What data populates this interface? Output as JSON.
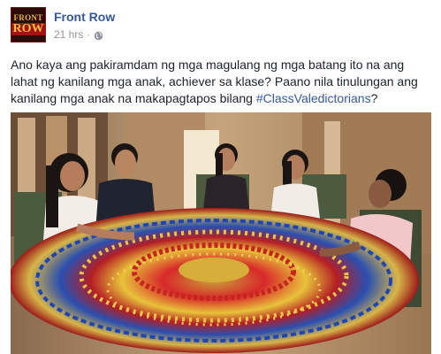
{
  "post": {
    "page_name": "Front Row",
    "timestamp": "21 hrs",
    "separator": "·",
    "privacy_icon": "globe-icon",
    "text_before_hashtag": "Ano kaya ang pakiramdam ng mga magulang ng mga batang ito na ang lahat ng kanilang mga anak, achiever sa klase? Paano nila tinulungan ang kanilang mga anak na makapagtapos bilang ",
    "hashtag": "#ClassValedictorians",
    "text_after_hashtag": "?"
  },
  "avatar": {
    "line1": "FRONT",
    "line2": "ROW"
  },
  "colors": {
    "link": "#365899",
    "text": "#1d2129",
    "meta": "#90949c"
  }
}
